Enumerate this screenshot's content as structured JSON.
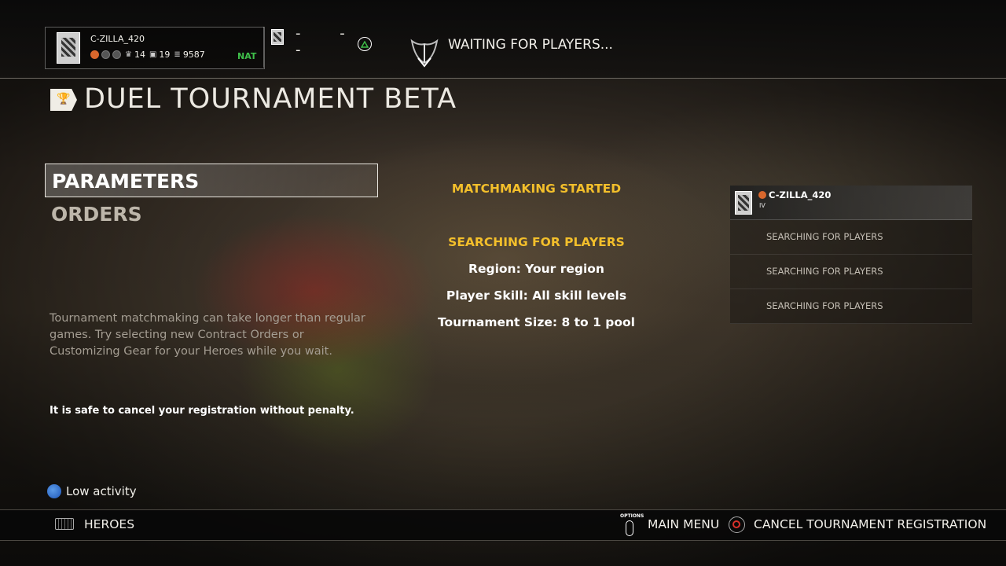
{
  "header": {
    "player_name": "C-ZILLA_420",
    "stats": {
      "stat_a": "14",
      "stat_b": "19",
      "stat_c": "9587"
    },
    "nat_type": "NAT",
    "party_slots": "- - -",
    "waiting_text": "WAITING FOR PLAYERS..."
  },
  "page": {
    "title": "DUEL TOURNAMENT BETA"
  },
  "menu": {
    "items": [
      {
        "label": "PARAMETERS",
        "selected": true
      },
      {
        "label": "ORDERS",
        "selected": false
      }
    ]
  },
  "info": {
    "tip": "Tournament matchmaking can take longer than regular games. Try selecting new Contract Orders or Customizing Gear for your Heroes while you wait.",
    "safe_notice": "It is safe to cancel your registration without penalty.",
    "activity": "Low activity"
  },
  "matchmaking": {
    "status": "MATCHMAKING STARTED",
    "search_status": "SEARCHING FOR PLAYERS",
    "details": [
      "Region: Your region",
      "Player Skill: All skill levels",
      "Tournament Size: 8 to 1 pool"
    ]
  },
  "roster": {
    "player": {
      "name": "C-ZILLA_420",
      "rank": "IV"
    },
    "slots": [
      "SEARCHING FOR PLAYERS",
      "SEARCHING FOR PLAYERS",
      "SEARCHING FOR PLAYERS"
    ]
  },
  "footer": {
    "heroes": "HEROES",
    "options_label": "OPTIONS",
    "main_menu": "MAIN MENU",
    "cancel": "CANCEL TOURNAMENT REGISTRATION"
  },
  "colors": {
    "accent_yellow": "#f3bf2b",
    "nat_green": "#3fbf4a",
    "cancel_red": "#d9302a"
  },
  "icons": [
    "emblem-icon",
    "triangle-button-icon",
    "waiting-helm-icon",
    "trophy-icon",
    "globe-icon",
    "keyboard-icon",
    "options-button-icon",
    "circle-button-icon"
  ]
}
